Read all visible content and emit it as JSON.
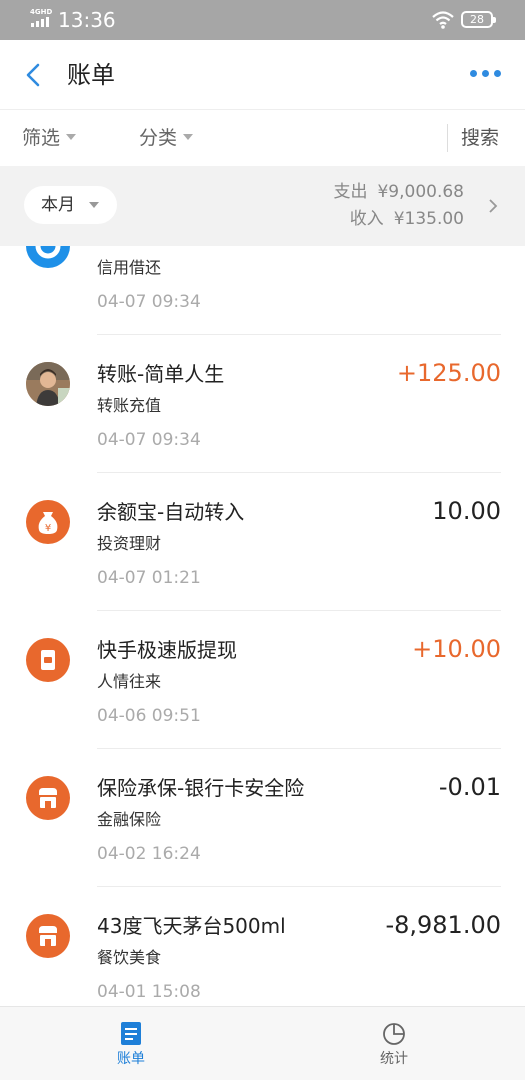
{
  "status_bar": {
    "network": "4GHD",
    "time": "13:36",
    "battery": "28"
  },
  "header": {
    "title": "账单",
    "back_icon": "back-chevron-icon",
    "more_icon": "more-dots-icon",
    "accent": "#2f8be0"
  },
  "filters": {
    "filter_label": "筛选",
    "category_label": "分类",
    "search_label": "搜索"
  },
  "summary": {
    "month_label": "本月",
    "expense_label": "支出",
    "expense_amount": "¥9,000.68",
    "income_label": "收入",
    "income_amount": "¥135.00"
  },
  "transactions": [
    {
      "name": "",
      "category": "信用借还",
      "datetime": "04-07  09:34",
      "amount": "",
      "icon": "credit-repay-icon",
      "icon_color": "#1e90e8"
    },
    {
      "name": "转账-简单人生",
      "category": "转账充值",
      "datetime": "04-07  09:34",
      "amount": "+125.00",
      "icon": "user-avatar",
      "positive": true
    },
    {
      "name": "余额宝-自动转入",
      "category": "投资理财",
      "datetime": "04-07  01:21",
      "amount": "10.00",
      "icon": "money-bag-icon",
      "icon_color": "#e8682d"
    },
    {
      "name": "快手极速版提现",
      "category": "人情往来",
      "datetime": "04-06  09:51",
      "amount": "+10.00",
      "icon": "red-envelope-icon",
      "icon_color": "#e8682d",
      "positive": true
    },
    {
      "name": "保险承保-银行卡安全险",
      "category": "金融保险",
      "datetime": "04-02  16:24",
      "amount": "-0.01",
      "icon": "shop-icon",
      "icon_color": "#e8682d"
    },
    {
      "name": "43度飞天茅台500ml",
      "category": "餐饮美食",
      "datetime": "04-01  15:08",
      "amount": "-8,981.00",
      "icon": "shop-icon",
      "icon_color": "#e8682d"
    }
  ],
  "tabbar": {
    "bills_label": "账单",
    "stats_label": "统计",
    "active_color": "#1e7fd8"
  },
  "colors": {
    "positive_amount": "#e8682d",
    "summary_bg": "#f2f2f2"
  }
}
